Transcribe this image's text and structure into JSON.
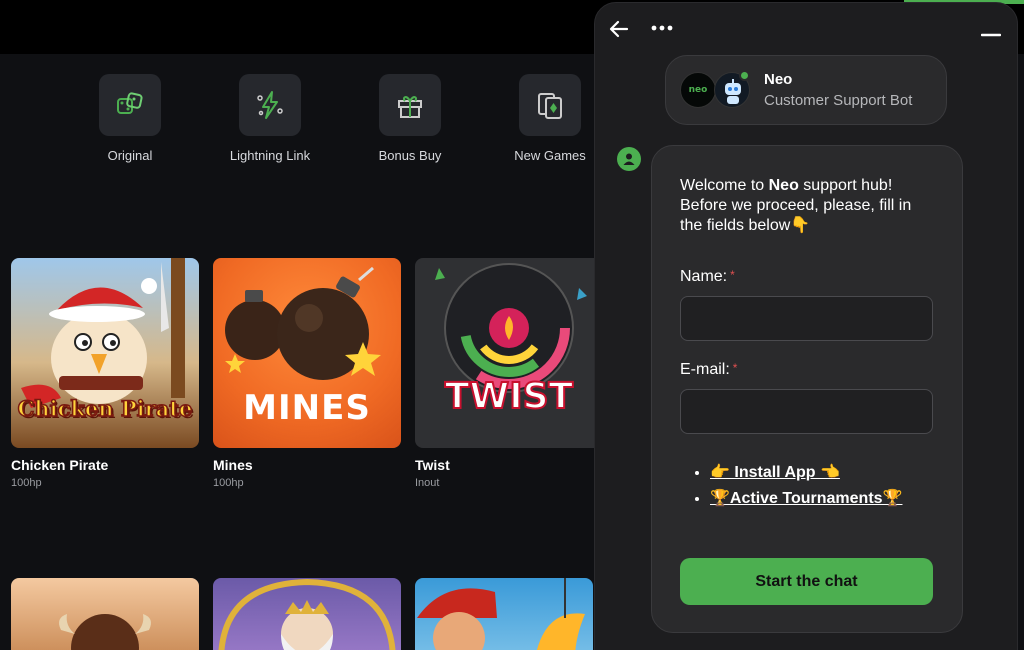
{
  "categories": [
    {
      "label": "Original",
      "icon": "dice-icon"
    },
    {
      "label": "Lightning Link",
      "icon": "lightning-icon"
    },
    {
      "label": "Bonus Buy",
      "icon": "gift-icon"
    },
    {
      "label": "New Games",
      "icon": "cards-icon"
    }
  ],
  "games": [
    {
      "name": "Chicken Pirate",
      "provider": "100hp",
      "art_text": "Chicken Pirate"
    },
    {
      "name": "Mines",
      "provider": "100hp",
      "art_text": "MINES"
    },
    {
      "name": "Twist",
      "provider": "Inout",
      "art_text": "TWIST"
    }
  ],
  "chat": {
    "bot_logo_text": "neo",
    "bot_name": "Neo",
    "bot_role": "Customer Support Bot",
    "welcome_prefix": "Welcome to ",
    "welcome_brand": "Neo",
    "welcome_suffix": " support hub! Before we proceed, please, fill in the fields below👇",
    "name_label": "Name:",
    "email_label": "E-mail:",
    "required_mark": "*",
    "name_value": "",
    "email_value": "",
    "links": [
      "👉 Install App 👈",
      "🏆Active Tournaments🏆"
    ],
    "start_button": "Start the chat"
  },
  "colors": {
    "accent": "#4caf50",
    "panel": "#1d1d1f",
    "card": "#2a2a2c",
    "background": "#0f1013"
  }
}
